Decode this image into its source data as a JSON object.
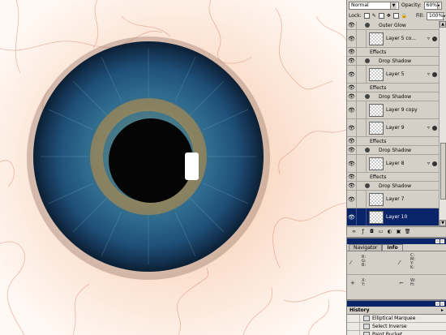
{
  "layers_panel": {
    "blend_mode": "Normal",
    "opacity_label": "Opacity:",
    "opacity_value": "60%",
    "lock_label": "Lock:",
    "fill_label": "Fill:",
    "fill_value": "100%",
    "rows": [
      {
        "kind": "effect",
        "name": "Outer Glow"
      },
      {
        "kind": "layer",
        "name": "Layer 5 co...",
        "fx": true
      },
      {
        "kind": "effect-group",
        "name": "Effects"
      },
      {
        "kind": "effect",
        "name": "Drop Shadow"
      },
      {
        "kind": "layer",
        "name": "Layer 5",
        "fx": true
      },
      {
        "kind": "effect-group",
        "name": "Effects"
      },
      {
        "kind": "effect",
        "name": "Drop Shadow"
      },
      {
        "kind": "layer",
        "name": "Layer 9 copy",
        "fx": false
      },
      {
        "kind": "layer",
        "name": "Layer 9",
        "fx": true
      },
      {
        "kind": "effect-group",
        "name": "Effects"
      },
      {
        "kind": "effect",
        "name": "Drop Shadow"
      },
      {
        "kind": "layer",
        "name": "Layer 8",
        "fx": true
      },
      {
        "kind": "effect-group",
        "name": "Effects"
      },
      {
        "kind": "effect",
        "name": "Drop Shadow"
      },
      {
        "kind": "layer",
        "name": "Layer 7",
        "fx": false
      },
      {
        "kind": "layer",
        "name": "Layer 10",
        "fx": false,
        "selected": true
      }
    ],
    "fx_symbol": "▿",
    "eye_symbol": "👁",
    "footer_icons": [
      "link-icon",
      "add-style-icon",
      "mask-icon",
      "new-set-icon",
      "adjustment-layer-icon",
      "new-layer-icon",
      "trash-icon"
    ]
  },
  "info_panel": {
    "tab_navigator": "Navigator",
    "tab_info": "Info",
    "rgb_labels": "R:\nG:\nB:",
    "cmyk_labels": "C:\nM:\nY:\nK:",
    "xy_labels": "X:\nY:",
    "wh_labels": "W:\nH:"
  },
  "history_panel": {
    "title": "History",
    "items": [
      "Elliptical Marquee",
      "Select Inverse",
      "Paint Bucket"
    ]
  },
  "colors": {
    "selection": "#0a246a",
    "panel_bg": "#d4d0c8",
    "iris_blue": "#1e4e78"
  }
}
